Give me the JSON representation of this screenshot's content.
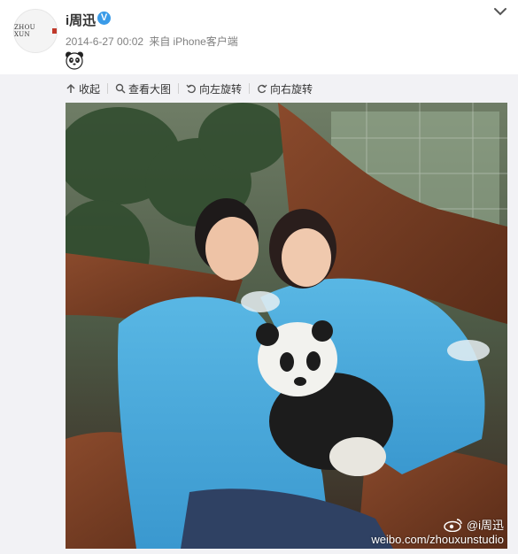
{
  "post": {
    "author": "i周迅",
    "avatar_text": "ZHOU XUN",
    "timestamp": "2014-6-27 00:02",
    "source_prefix": "来自",
    "source": "iPhone客户端",
    "content_emoji": "panda-emoji"
  },
  "toolbar": {
    "collapse": "收起",
    "view_full": "查看大图",
    "rotate_left": "向左旋转",
    "rotate_right": "向右旋转"
  },
  "photo": {
    "watermark_handle": "@i周迅",
    "watermark_url": "weibo.com/zhouxunstudio"
  },
  "icons": {
    "verified": "verified-v-icon",
    "menu": "chevron-down-icon",
    "collapse": "arrow-up-icon",
    "zoom": "magnifier-icon",
    "rotate_left": "rotate-left-icon",
    "rotate_right": "rotate-right-icon",
    "weibo": "weibo-logo-icon"
  },
  "colors": {
    "verified": "#3a9be8",
    "meta_text": "#808080",
    "background": "#f2f2f5"
  }
}
